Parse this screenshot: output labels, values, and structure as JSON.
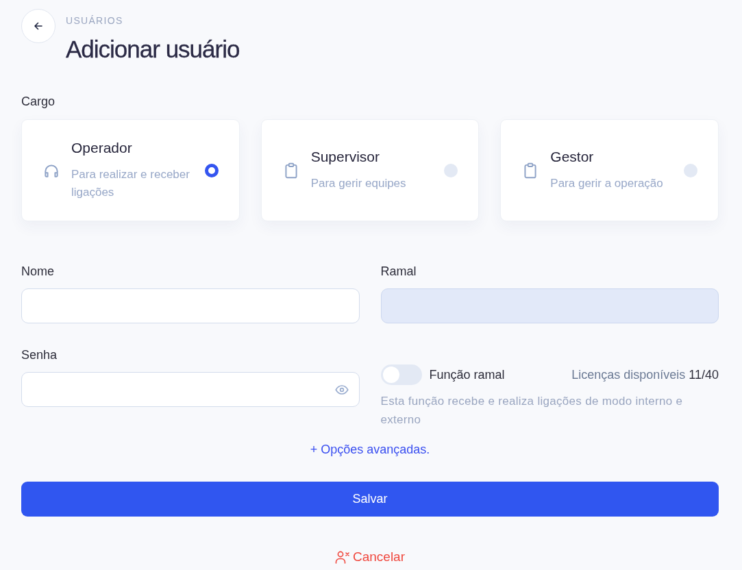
{
  "header": {
    "breadcrumb": "USUÁRIOS",
    "title": "Adicionar usuário"
  },
  "role": {
    "label": "Cargo",
    "options": [
      {
        "kind": "headset",
        "title": "Operador",
        "description": "Para realizar e receber ligações",
        "selected": true
      },
      {
        "kind": "clipboard",
        "title": "Supervisor",
        "description": "Para gerir equipes",
        "selected": false
      },
      {
        "kind": "clipboard",
        "title": "Gestor",
        "description": "Para gerir a operação",
        "selected": false
      }
    ]
  },
  "fields": [
    {
      "kind": "text",
      "label": "Nome",
      "disabled": false
    },
    {
      "kind": "text",
      "label": "Ramal",
      "disabled": true
    },
    {
      "kind": "password",
      "label": "Senha",
      "disabled": false
    }
  ],
  "extension_function": {
    "label": "Função ramal",
    "on": false,
    "licenses_label": "Licenças disponíveis",
    "licenses_count": "11/40",
    "help": "Esta função recebe e realiza ligações de modo interno e externo"
  },
  "advanced_link": "+ Opções avançadas.",
  "save_button": "Salvar",
  "cancel_button": "Cancelar"
}
